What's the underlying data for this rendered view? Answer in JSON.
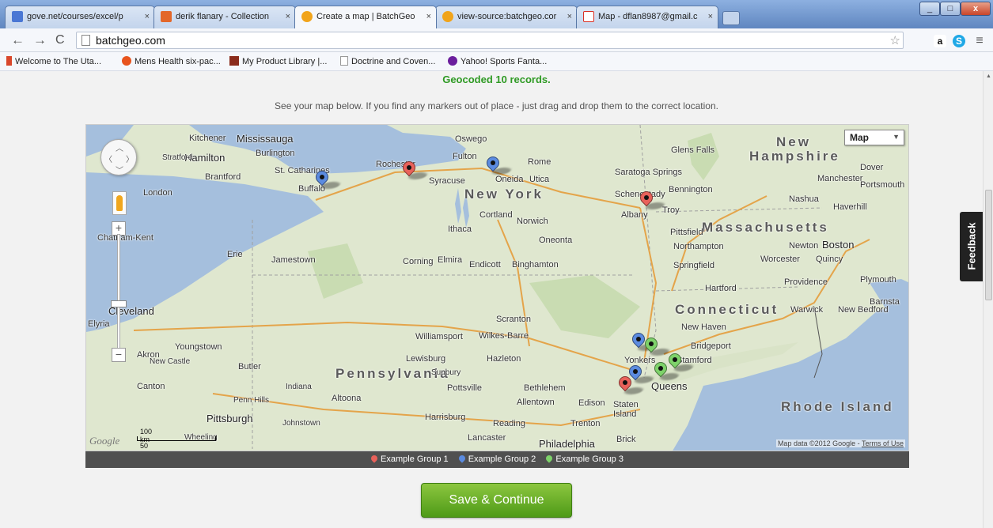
{
  "browser": {
    "tabs": [
      {
        "label": "gove.net/courses/excel/p",
        "favicon_color": "#4a77d4",
        "active": false
      },
      {
        "label": "derik flanary - Collection",
        "favicon_color": "#e3672a",
        "active": false
      },
      {
        "label": "Create a map | BatchGeo",
        "favicon_color": "#f1a41b",
        "active": true
      },
      {
        "label": "view-source:batchgeo.cor",
        "favicon_color": "#f1a41b",
        "active": false
      },
      {
        "label": "Map - dflan8987@gmail.c",
        "favicon_color": "#d93025",
        "active": false
      }
    ],
    "tab_close_glyph": "×",
    "url": "batchgeo.com",
    "bookmarks": [
      {
        "label": "Welcome to The Uta...",
        "icon_color": "#d9472b"
      },
      {
        "label": "Mens Health six-pac...",
        "icon_color": "#e8541d"
      },
      {
        "label": "My Product Library |...",
        "icon_color": "#8b2c1c"
      },
      {
        "label": "Doctrine and Coven...",
        "icon_color": "#aaaaaa"
      },
      {
        "label": "Yahoo! Sports Fanta...",
        "icon_color": "#6b1e9d"
      }
    ]
  },
  "page": {
    "geocoded_text": "Geocoded 10 records.",
    "instructions": "See your map below. If you find any markers out of place - just drag and drop them to the correct location.",
    "map_type_label": "Map",
    "scale_km": "100 km",
    "scale_mi": "50 mi",
    "google_logo": "Google",
    "attribution": "Map data ©2012 Google - ",
    "terms_label": "Terms of Use",
    "feedback_label": "Feedback",
    "save_button_label": "Save & Continue"
  },
  "legend": [
    {
      "label": "Example Group 1",
      "color": "#e8615a"
    },
    {
      "label": "Example Group 2",
      "color": "#5b8be0"
    },
    {
      "label": "Example Group 3",
      "color": "#7ed26a"
    }
  ],
  "markers": [
    {
      "group": 1,
      "color": "#e8615a",
      "place": "Rochester"
    },
    {
      "group": 1,
      "color": "#e8615a",
      "place": "Schenectady"
    },
    {
      "group": 1,
      "color": "#e8615a",
      "place": "New York"
    },
    {
      "group": 2,
      "color": "#5b8be0",
      "place": "Buffalo"
    },
    {
      "group": 2,
      "color": "#5b8be0",
      "place": "Syracuse"
    },
    {
      "group": 2,
      "color": "#5b8be0",
      "place": "Yonkers"
    },
    {
      "group": 2,
      "color": "#5b8be0",
      "place": "New York"
    },
    {
      "group": 3,
      "color": "#7ed26a",
      "place": "Yonkers"
    },
    {
      "group": 3,
      "color": "#7ed26a",
      "place": "Stamford"
    },
    {
      "group": 3,
      "color": "#7ed26a",
      "place": "Queens"
    }
  ],
  "map_labels": {
    "states": [
      "New York",
      "Pennsylvania",
      "Massachusetts",
      "Connecticut",
      "Rhode Island",
      "New",
      "Hampshire"
    ],
    "cities": [
      "Kitchener",
      "Mississauga",
      "Hamilton",
      "Burlington",
      "St. Catharines",
      "Buffalo",
      "Brantford",
      "London",
      "Stratford",
      "Chatham-Kent",
      "Erie",
      "Jamestown",
      "Rochester",
      "Oswego",
      "Fulton",
      "Rome",
      "Syracuse",
      "Oneida",
      "Utica",
      "Cortland",
      "Norwich",
      "Ithaca",
      "Oneonta",
      "Corning",
      "Elmira",
      "Endicott",
      "Binghamton",
      "Glens Falls",
      "Saratoga Springs",
      "Bennington",
      "Schenectady",
      "Albany",
      "Troy",
      "Pittsfield",
      "Northampton",
      "Springfield",
      "Worcester",
      "Boston",
      "Newton",
      "Quincy",
      "Providence",
      "Plymouth",
      "Manchester",
      "Portsmouth",
      "Dover",
      "Nashua",
      "Haverhill",
      "Hartford",
      "New Haven",
      "Bridgeport",
      "Stamford",
      "Warwick",
      "New Bedford",
      "Barnsta",
      "Cleveland",
      "Elyria",
      "Akron",
      "Youngstown",
      "New Castle",
      "Butler",
      "Canton",
      "Penn Hills",
      "Pittsburgh",
      "Johnstown",
      "Indiana",
      "Altoona",
      "Williamsport",
      "Wilkes-Barre",
      "Scranton",
      "Lewisburg",
      "Hazleton",
      "Sunbury",
      "Pottsville",
      "Bethlehem",
      "Allentown",
      "Harrisburg",
      "Reading",
      "Lancaster",
      "Philadelphia",
      "Trenton",
      "Edison",
      "Staten Island",
      "Brick",
      "Yonkers",
      "Queens",
      "Wheeling"
    ]
  }
}
